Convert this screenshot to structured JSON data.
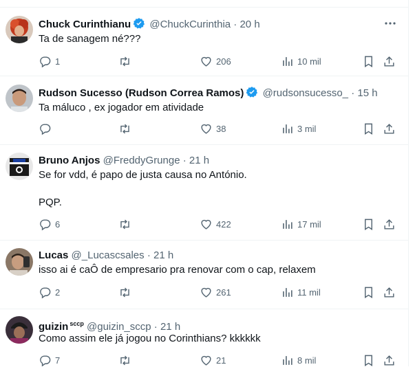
{
  "tweets": [
    {
      "name": "Chuck Curinthianu",
      "verified": true,
      "handle": "@ChuckCurinthia",
      "separator": "·",
      "time": "20 h",
      "text": "Ta de sanagem né???",
      "replies": "1",
      "retweets": "",
      "likes": "206",
      "views": "10 mil",
      "avatar": "avatar-red-hair"
    },
    {
      "name": "Rudson Sucesso (Rudson Correa Ramos)",
      "verified": true,
      "handle": "@rudsonsucesso_",
      "separator": "·",
      "time": "15 h",
      "text": "Ta máluco , ex jogador em atividade",
      "replies": "",
      "retweets": "",
      "likes": "38",
      "views": "3 mil",
      "avatar": "avatar-man"
    },
    {
      "name": "Bruno Anjos",
      "verified": false,
      "handle": "@FreddyGrunge",
      "separator": "·",
      "time": "21 h",
      "text": "Se for vdd, é papo de justa causa no António.\n\nPQP.",
      "replies": "6",
      "retweets": "",
      "likes": "422",
      "views": "17 mil",
      "avatar": "avatar-shirt"
    },
    {
      "name": "Lucas",
      "verified": false,
      "handle": "@_Lucascsales",
      "separator": "·",
      "time": "21 h",
      "text": "isso ai é caÔ de empresario pra renovar com o cap, relaxem",
      "replies": "2",
      "retweets": "",
      "likes": "261",
      "views": "11 mil",
      "avatar": "avatar-selfie"
    },
    {
      "name": "guizin",
      "name_suffix": "sccp",
      "verified": false,
      "handle": "@guizin_sccp",
      "separator": "·",
      "time": "21 h",
      "text": "Como assim ele já jogou no Corinthians? kkkkkk",
      "replies": "7",
      "retweets": "",
      "likes": "21",
      "views": "8 mil",
      "avatar": "avatar-cap"
    }
  ],
  "colors": {
    "text_primary": "#0f1419",
    "text_secondary": "#536471",
    "verified_blue": "#1d9bf0",
    "divider": "#eff3f4"
  }
}
